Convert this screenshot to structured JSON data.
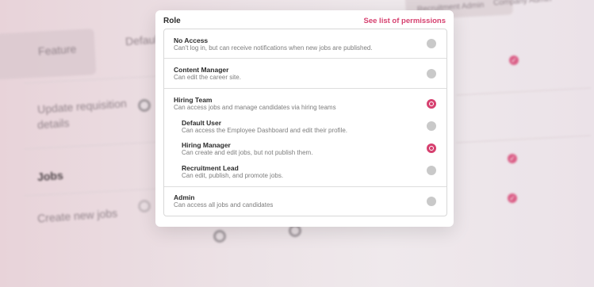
{
  "background": {
    "feature_header": "Feature",
    "default_user_header": "Default Us",
    "recruitment_admin_header": "Recruitment Admin",
    "company_admin_header": "Company Admin",
    "row_update": "Update requisition",
    "row_update_2": "details",
    "row_jobs": "Jobs",
    "row_create": "Create new jobs"
  },
  "modal": {
    "title": "Role",
    "permissions_link": "See list of permissions",
    "options": [
      {
        "name": "No Access",
        "description": "Can't log in, but can receive notifications when new jobs are published.",
        "selected": false
      },
      {
        "name": "Content Manager",
        "description": "Can edit the career site.",
        "selected": false
      },
      {
        "name": "Hiring Team",
        "description": "Can access jobs and manage candidates via hiring teams",
        "selected": true
      },
      {
        "name": "Default User",
        "description": "Can access the Employee Dashboard and edit their profile.",
        "selected": false
      },
      {
        "name": "Hiring Manager",
        "description": "Can create and edit jobs, but not publish them.",
        "selected": true
      },
      {
        "name": "Recruitment Lead",
        "description": "Can edit, publish, and promote jobs.",
        "selected": false
      },
      {
        "name": "Admin",
        "description": "Can access all jobs and candidates",
        "selected": false
      }
    ]
  },
  "colors": {
    "accent": "#d6406f",
    "radio_off": "#c9c9c9"
  }
}
